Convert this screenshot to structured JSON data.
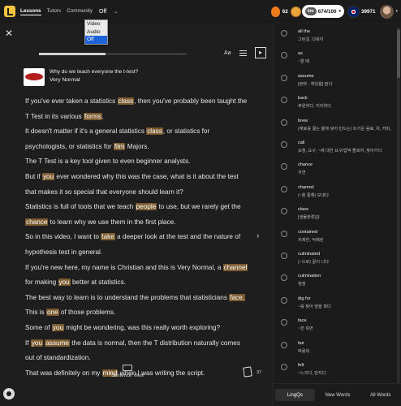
{
  "nav": {
    "items": [
      "Lessons",
      "Tutors",
      "Community"
    ],
    "audio_mode": {
      "selected": "Off",
      "options": [
        "Video",
        "Audio",
        "Off"
      ]
    }
  },
  "stats": {
    "streak": "62",
    "coins_badge": "6m",
    "known_words": "674/100",
    "linq_points": "39971",
    "flame_color": "#f07b1c"
  },
  "lesson": {
    "title": "Why do we teach everyone the t-test?",
    "subtitle": "Very Normal",
    "progress_fraction": 0.45,
    "font_button": "Aa"
  },
  "paragraphs": [
    [
      {
        "t": "If you've ever taken a statistics "
      },
      {
        "t": "class",
        "h": true
      },
      {
        "t": ", then you've probably been taught the T Test in its various "
      },
      {
        "t": "forms",
        "h": true
      },
      {
        "t": "."
      }
    ],
    [
      {
        "t": "It doesn't matter if it's a general statistics "
      },
      {
        "t": "class",
        "h": true
      },
      {
        "t": ", or statistics for psychologists, or statistics for "
      },
      {
        "t": "film",
        "h": true
      },
      {
        "t": " Majors."
      }
    ],
    [
      {
        "t": "The T Test is a key tool given to even beginner analysts."
      }
    ],
    [
      {
        "t": "But if "
      },
      {
        "t": "you",
        "h": true
      },
      {
        "t": " ever wondered why this was the case, what is it about the test that makes it so special that everyone should learn it?"
      }
    ],
    [
      {
        "t": "Statistics is full of tools that we teach "
      },
      {
        "t": "people",
        "h": true
      },
      {
        "t": " to use, but we rarely get the "
      },
      {
        "t": "chance",
        "h": true
      },
      {
        "t": " to learn why we use them in the first place."
      }
    ],
    [
      {
        "t": "So in this video, I want to "
      },
      {
        "t": "take",
        "h": true
      },
      {
        "t": " a deeper look at the test and the nature of hypothesis test in general."
      }
    ],
    [
      {
        "t": "If you're new here, my name is Christian and this is Very Normal, a "
      },
      {
        "t": "channel",
        "h": true
      },
      {
        "t": " for making "
      },
      {
        "t": "you",
        "h": true
      },
      {
        "t": " better at statistics."
      }
    ],
    [
      {
        "t": "The best way to learn is to understand the problems that statisticians "
      },
      {
        "t": "face.",
        "h": true
      }
    ],
    [
      {
        "t": "This is "
      },
      {
        "t": "one",
        "h": true
      },
      {
        "t": " of those problems."
      }
    ],
    [
      {
        "t": "Some of "
      },
      {
        "t": "you",
        "h": true
      },
      {
        "t": " might be wondering, was this really worth exploring?"
      }
    ],
    [
      {
        "t": "If "
      },
      {
        "t": "you",
        "h": true
      },
      {
        "t": " "
      },
      {
        "t": "assume",
        "h": true
      },
      {
        "t": " the data is normal, then the T distribution naturally comes out of standardization."
      }
    ],
    [
      {
        "t": "That was definitely on my "
      },
      {
        "t": "mind",
        "h": true
      },
      {
        "t": " when I was writing the script."
      }
    ]
  ],
  "bottom": {
    "sentence_view": "Sentence View",
    "cards_count": "37"
  },
  "vocab": [
    {
      "term": "all the",
      "meaning": "그런걸, 다워지"
    },
    {
      "term": "as",
      "meaning": "~할 때"
    },
    {
      "term": "assume",
      "meaning": "[권력 · 책임을] 맡다"
    },
    {
      "term": "back",
      "meaning": "후원하다, 지지하다"
    },
    {
      "term": "brew",
      "meaning": "(재료를 끓는 물에 넣어 만드는) 뜨거운 음료, 차, 커피,"
    },
    {
      "term": "call",
      "meaning": "요청, 요구, ~에 대한 요구/압박 플로하, 찾아가다"
    },
    {
      "term": "chance",
      "meaning": "우연"
    },
    {
      "term": "channel",
      "meaning": "(~을 통해) 보내다"
    },
    {
      "term": "class",
      "meaning": "[생물분류]강"
    },
    {
      "term": "contained",
      "meaning": "자제한, 억제된"
    },
    {
      "term": "culminated",
      "meaning": "(~으로) 끝이 나다"
    },
    {
      "term": "culmination",
      "meaning": "정점"
    },
    {
      "term": "dig for",
      "meaning": "~를 찾아 땅을 파다"
    },
    {
      "term": "face",
      "meaning": "~한 측면"
    },
    {
      "term": "fair",
      "meaning": "박람회"
    },
    {
      "term": "felt",
      "meaning": "~느끼다, 만지다"
    }
  ],
  "sidebar_tabs": [
    "LingQs",
    "New Words",
    "All Words"
  ],
  "colors": {
    "background": "#1e1e1e",
    "highlight": "#7a5a2e",
    "dropdown_selected": "#1f63d8"
  }
}
